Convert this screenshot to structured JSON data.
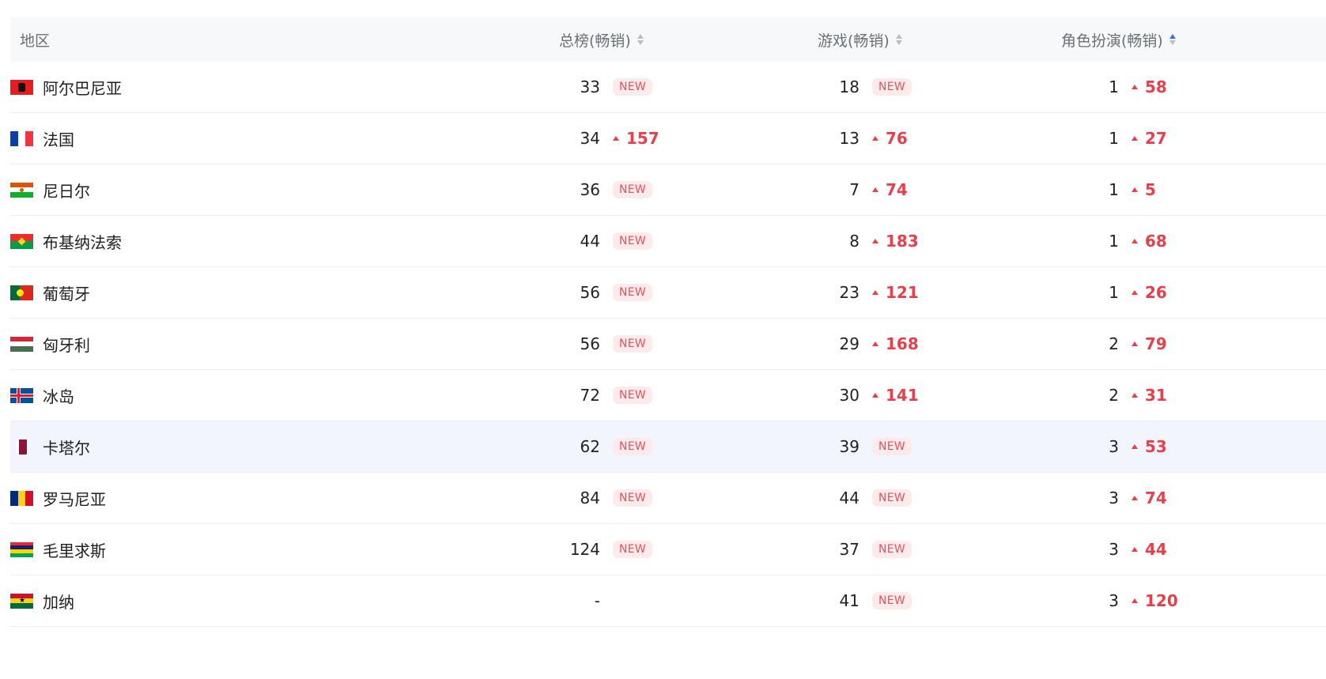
{
  "columns": {
    "region": "地区",
    "overall": "总榜(畅销)",
    "games": "游戏(畅销)",
    "rpg": "角色扮演(畅销)"
  },
  "new_label": "NEW",
  "rows": [
    {
      "region": "阿尔巴尼亚",
      "flag": "albania",
      "overall": "33",
      "overall_chg": "NEW",
      "games": "18",
      "games_chg": "NEW",
      "rpg": "1",
      "rpg_chg": "58"
    },
    {
      "region": "法国",
      "flag": "france",
      "overall": "34",
      "overall_chg": "157",
      "games": "13",
      "games_chg": "76",
      "rpg": "1",
      "rpg_chg": "27"
    },
    {
      "region": "尼日尔",
      "flag": "niger",
      "overall": "36",
      "overall_chg": "NEW",
      "games": "7",
      "games_chg": "74",
      "rpg": "1",
      "rpg_chg": "5"
    },
    {
      "region": "布基纳法索",
      "flag": "burkina-faso",
      "overall": "44",
      "overall_chg": "NEW",
      "games": "8",
      "games_chg": "183",
      "rpg": "1",
      "rpg_chg": "68"
    },
    {
      "region": "葡萄牙",
      "flag": "portugal",
      "overall": "56",
      "overall_chg": "NEW",
      "games": "23",
      "games_chg": "121",
      "rpg": "1",
      "rpg_chg": "26"
    },
    {
      "region": "匈牙利",
      "flag": "hungary",
      "overall": "56",
      "overall_chg": "NEW",
      "games": "29",
      "games_chg": "168",
      "rpg": "2",
      "rpg_chg": "79"
    },
    {
      "region": "冰岛",
      "flag": "iceland",
      "overall": "72",
      "overall_chg": "NEW",
      "games": "30",
      "games_chg": "141",
      "rpg": "2",
      "rpg_chg": "31"
    },
    {
      "region": "卡塔尔",
      "flag": "qatar",
      "overall": "62",
      "overall_chg": "NEW",
      "games": "39",
      "games_chg": "NEW",
      "rpg": "3",
      "rpg_chg": "53"
    },
    {
      "region": "罗马尼亚",
      "flag": "romania",
      "overall": "84",
      "overall_chg": "NEW",
      "games": "44",
      "games_chg": "NEW",
      "rpg": "3",
      "rpg_chg": "74"
    },
    {
      "region": "毛里求斯",
      "flag": "mauritius",
      "overall": "124",
      "overall_chg": "NEW",
      "games": "37",
      "games_chg": "NEW",
      "rpg": "3",
      "rpg_chg": "44"
    },
    {
      "region": "加纳",
      "flag": "ghana",
      "overall": "-",
      "overall_chg": "",
      "games": "41",
      "games_chg": "NEW",
      "rpg": "3",
      "rpg_chg": "120"
    }
  ],
  "highlighted_row": "卡塔尔",
  "colors": {
    "up": "#ea3f4a",
    "new_bg": "#fdeaea",
    "header_bg": "#f7f8fa",
    "hover_bg": "#f2f5fd",
    "sort_active": "#3b6fe0"
  }
}
